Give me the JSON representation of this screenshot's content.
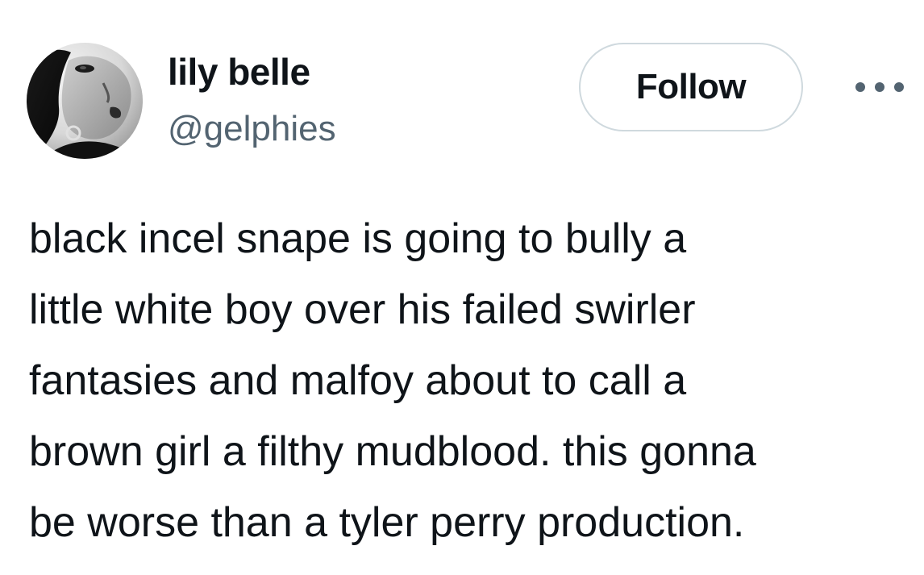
{
  "user": {
    "display_name": "lily belle",
    "handle": "@gelphies",
    "avatar_icon": "profile-photo"
  },
  "actions": {
    "follow_label": "Follow",
    "more_icon": "more-options-icon"
  },
  "tweet": {
    "text": "black incel snape is going to bully a\nlittle white boy over his failed swirler\nfantasies and malfoy about to call a\nbrown girl a filthy mudblood. this gonna\nbe worse than a tyler perry production."
  },
  "colors": {
    "text_primary": "#0f1419",
    "text_secondary": "#536471",
    "button_border": "#cfd9de",
    "background": "#ffffff"
  }
}
